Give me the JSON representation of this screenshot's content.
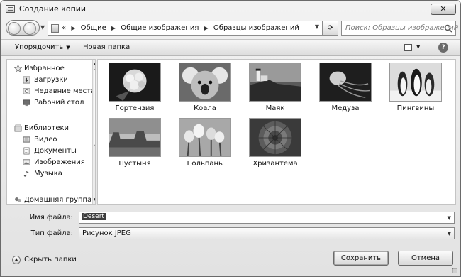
{
  "window": {
    "title": "Создание копии",
    "close_label": "✕"
  },
  "address": {
    "crumbs": [
      "Общие",
      "Общие изображения",
      "Образцы изображений"
    ],
    "lead": "«"
  },
  "search": {
    "placeholder": "Поиск: Образцы изображений"
  },
  "toolbar": {
    "organize": "Упорядочить",
    "new_folder": "Новая папка",
    "help": "?"
  },
  "nav": {
    "favorites": "Избранное",
    "downloads": "Загрузки",
    "recent": "Недавние места",
    "desktop": "Рабочий стол",
    "libraries": "Библиотеки",
    "video": "Видео",
    "documents": "Документы",
    "pictures": "Изображения",
    "music": "Музыка",
    "homegroup": "Домашняя группа"
  },
  "files": [
    {
      "name": "Гортензия",
      "icon": "hydrangea-thumbnail"
    },
    {
      "name": "Коала",
      "icon": "koala-thumbnail"
    },
    {
      "name": "Маяк",
      "icon": "lighthouse-thumbnail"
    },
    {
      "name": "Медуза",
      "icon": "jellyfish-thumbnail"
    },
    {
      "name": "Пингвины",
      "icon": "penguins-thumbnail"
    },
    {
      "name": "Пустыня",
      "icon": "desert-thumbnail"
    },
    {
      "name": "Тюльпаны",
      "icon": "tulips-thumbnail"
    },
    {
      "name": "Хризантема",
      "icon": "chrysanthemum-thumbnail"
    }
  ],
  "form": {
    "filename_label": "Имя файла:",
    "filename_value": "Desert",
    "filetype_label": "Тип файла:",
    "filetype_value": "Рисунок JPEG"
  },
  "footer": {
    "hide_folders": "Скрыть папки",
    "save": "Сохранить",
    "cancel": "Отмена"
  }
}
